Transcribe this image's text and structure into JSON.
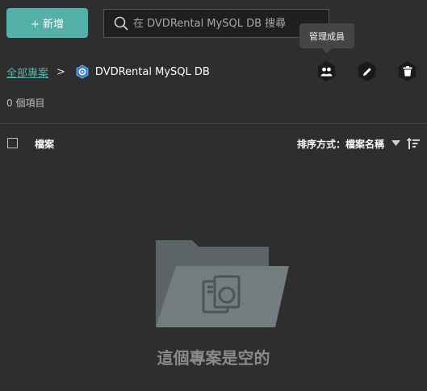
{
  "toolbar": {
    "new_label": "+ 新增",
    "search_placeholder": "在 DVDRental MySQL DB 搜尋"
  },
  "tooltip": {
    "text": "管理成員"
  },
  "breadcrumb": {
    "root": "全部專案",
    "separator": ">",
    "current": "DVDRental MySQL DB"
  },
  "actions": {
    "manage_members": "manage-members-icon",
    "edit": "pencil-icon",
    "delete": "trash-icon"
  },
  "summary": {
    "item_count": "0 個項目"
  },
  "list_header": {
    "file_column": "檔案",
    "sort_label": "排序方式：檔案名稱"
  },
  "empty_state": {
    "message": "這個專案是空的"
  },
  "colors": {
    "accent": "#55b1a8",
    "background": "#2e2e2e",
    "icon_button": "#1a1a1a",
    "empty_illustration": "#6e7779"
  }
}
